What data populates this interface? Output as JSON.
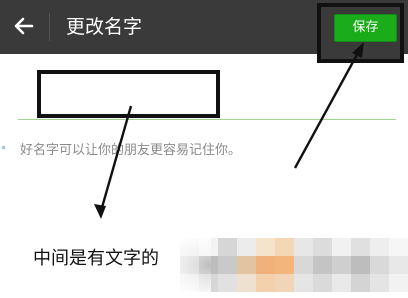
{
  "header": {
    "back_icon": "arrow-left-icon",
    "title": "更改名字",
    "save_label": "保存"
  },
  "form": {
    "name_value": "",
    "hint": "好名字可以让你的朋友更容易记住你。"
  },
  "annotation": {
    "caption": "中间是有文字的"
  },
  "colors": {
    "header_bg": "#3a3a3a",
    "save_green": "#1aad19",
    "underline": "#9fd68f"
  }
}
